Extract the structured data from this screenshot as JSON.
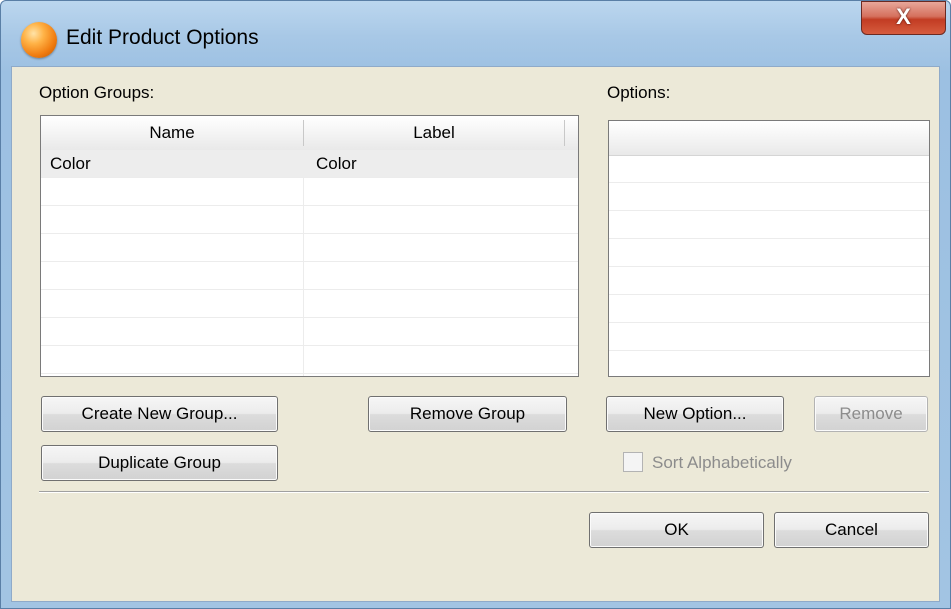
{
  "window": {
    "title": "Edit Product Options",
    "close_glyph": "X",
    "app_icon": "orange-sphere-icon"
  },
  "option_groups": {
    "label": "Option Groups:",
    "columns": [
      "Name",
      "Label"
    ],
    "rows": [
      {
        "name": "Color",
        "label": "Color"
      }
    ]
  },
  "options": {
    "label": "Options:"
  },
  "buttons": {
    "create_new_group": "Create New Group...",
    "remove_group": "Remove Group",
    "duplicate_group": "Duplicate Group",
    "new_option": "New Option...",
    "remove": "Remove",
    "ok": "OK",
    "cancel": "Cancel"
  },
  "sort_alphabetically": {
    "label": "Sort Alphabetically",
    "checked": false,
    "enabled": false
  }
}
